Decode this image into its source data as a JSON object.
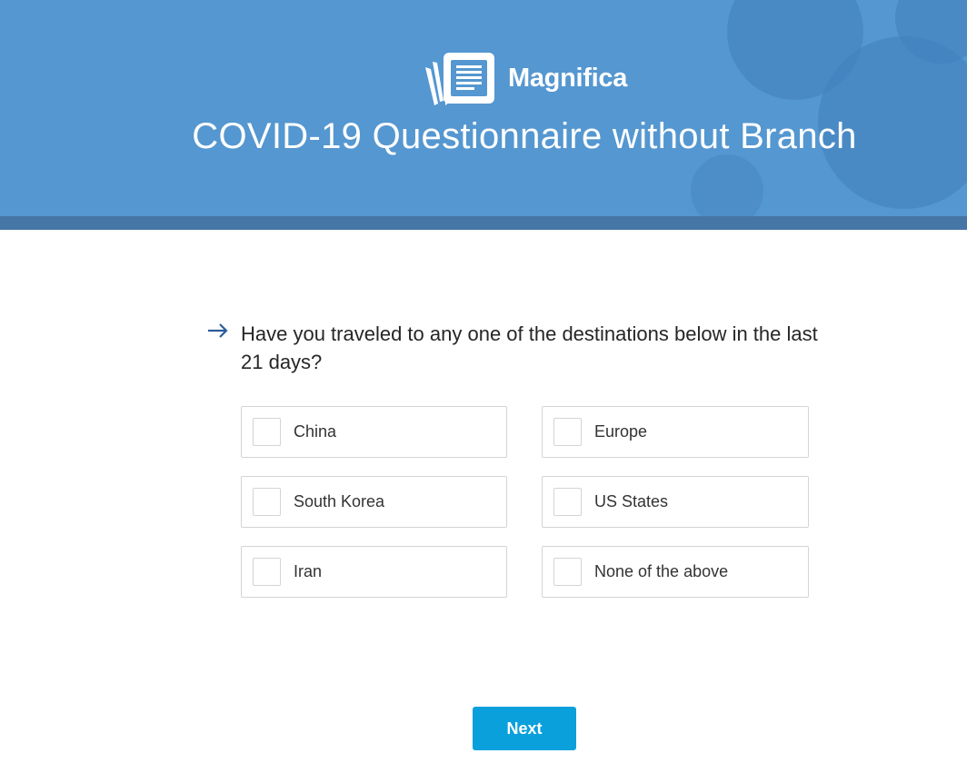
{
  "header": {
    "brand_name": "Magnifica",
    "survey_title": "COVID-19 Questionnaire without Branch",
    "background_color": "#5597d0",
    "logo_icon": "document-stack-icon"
  },
  "question": {
    "arrow_icon": "right-arrow-icon",
    "text": "Have you traveled to any one of the destinations below in the last 21 days?",
    "options": [
      {
        "label": "China",
        "checked": false
      },
      {
        "label": "Europe",
        "checked": false
      },
      {
        "label": "South Korea",
        "checked": false
      },
      {
        "label": "US States",
        "checked": false
      },
      {
        "label": "Iran",
        "checked": false
      },
      {
        "label": "None of the above",
        "checked": false
      }
    ]
  },
  "footer": {
    "next_label": "Next",
    "button_color": "#0aa0dc"
  }
}
